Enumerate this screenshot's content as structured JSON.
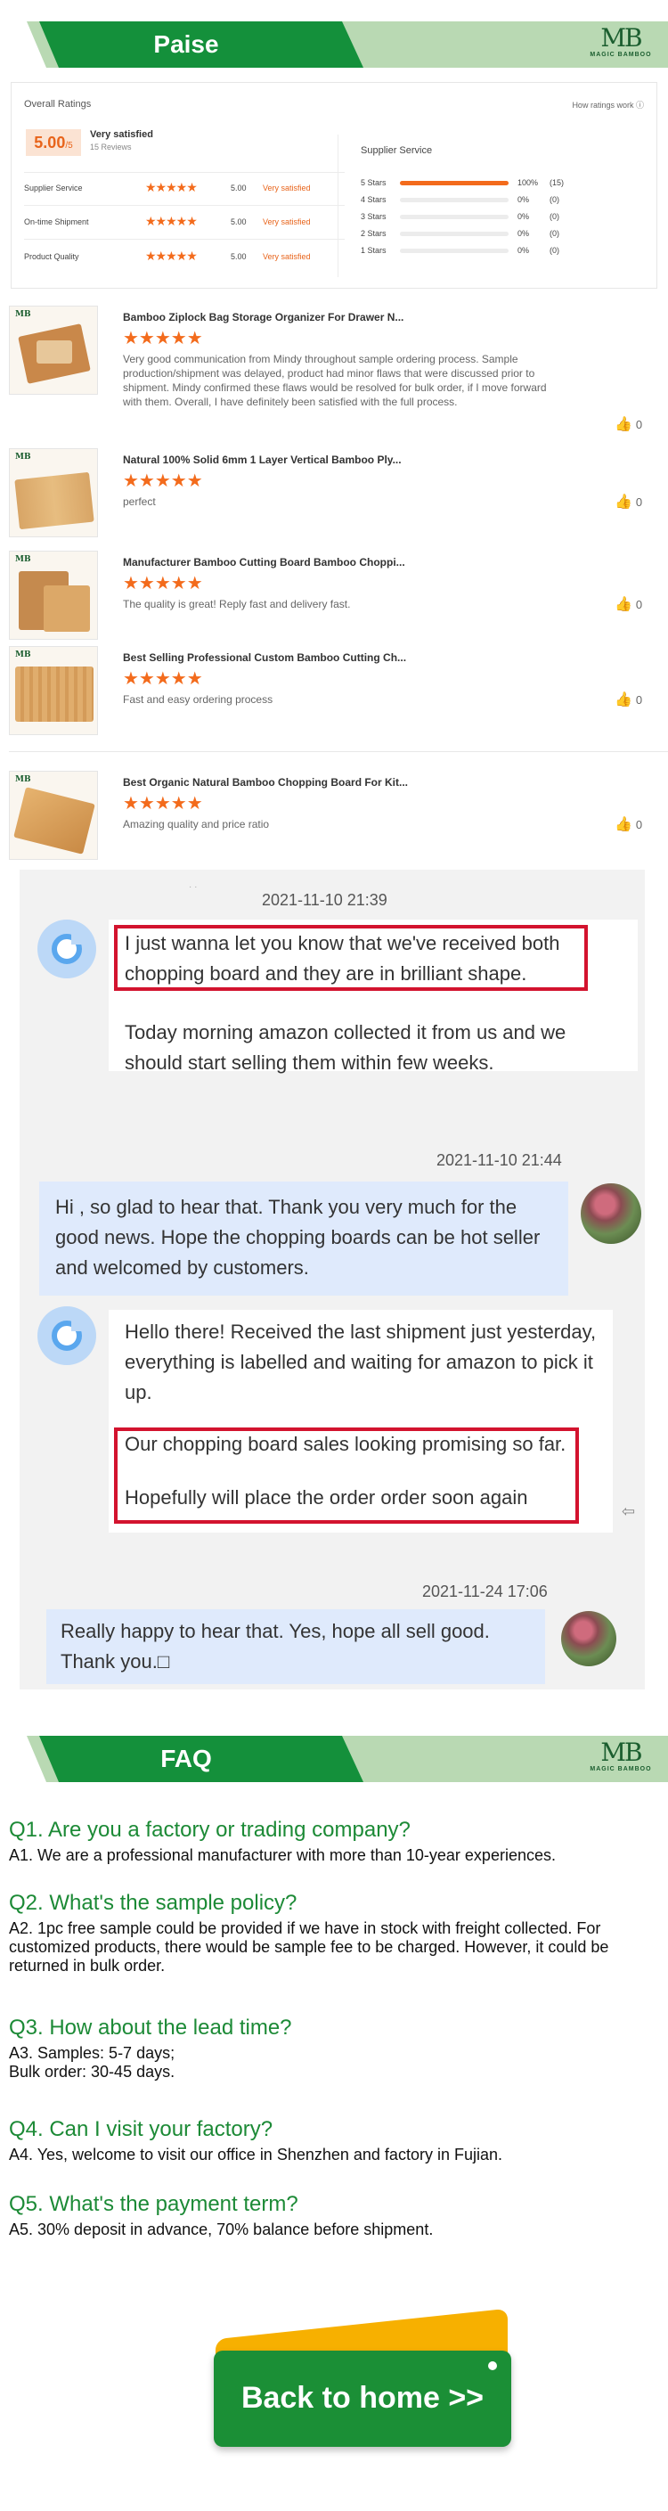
{
  "banner_paise": {
    "title": "Paise",
    "logo_mark": "MB",
    "logo_text": "MAGIC BAMBOO"
  },
  "ratings": {
    "title": "Overall Ratings",
    "how_link": "How ratings work",
    "score": "5.00",
    "score_suffix": "/5",
    "verdict": "Very satisfied",
    "reviews_count": "15 Reviews",
    "categories": [
      {
        "label": "Supplier Service",
        "stars": 5,
        "value": "5.00",
        "verdict": "Very satisfied"
      },
      {
        "label": "On-time Shipment",
        "stars": 5,
        "value": "5.00",
        "verdict": "Very satisfied"
      },
      {
        "label": "Product Quality",
        "stars": 5,
        "value": "5.00",
        "verdict": "Very satisfied"
      }
    ],
    "service_title": "Supplier Service",
    "distribution": [
      {
        "label": "5 Stars",
        "fraction": 1.0,
        "pct": "100%",
        "count": "(15)"
      },
      {
        "label": "4 Stars",
        "fraction": 0,
        "pct": "0%",
        "count": "(0)"
      },
      {
        "label": "3 Stars",
        "fraction": 0,
        "pct": "0%",
        "count": "(0)"
      },
      {
        "label": "2 Stars",
        "fraction": 0,
        "pct": "0%",
        "count": "(0)"
      },
      {
        "label": "1 Stars",
        "fraction": 0,
        "pct": "0%",
        "count": "(0)"
      }
    ]
  },
  "reviews": [
    {
      "product": "Bamboo Ziplock Bag Storage Organizer For Drawer N...",
      "stars": 5,
      "text": "Very good communication from Mindy throughout sample ordering process. Sample production/shipment was delayed, product had minor flaws that were discussed prior to shipment. Mindy confirmed these flaws would be resolved for bulk order, if I move forward with them. Overall, I have definitely been satisfied with the full process.",
      "likes": "0"
    },
    {
      "product": "Natural 100% Solid 6mm 1 Layer Vertical Bamboo Ply...",
      "stars": 5,
      "text": "perfect",
      "likes": "0"
    },
    {
      "product": "Manufacturer Bamboo Cutting Board Bamboo Choppi...",
      "stars": 5,
      "text": "The quality is great! Reply fast and delivery fast.",
      "likes": "0"
    },
    {
      "product": "Best Selling Professional Custom Bamboo Cutting Ch...",
      "stars": 5,
      "text": "Fast and easy ordering process",
      "likes": "0"
    },
    {
      "product": "Best Organic Natural Bamboo Chopping Board For Kit...",
      "stars": 5,
      "text": "Amazing quality and price ratio",
      "likes": "0"
    }
  ],
  "chat": {
    "dots": "·  ·",
    "ts1": "2021-11-10 21:39",
    "msg1a": "I just wanna let you know that we've received both chopping board and they are in brilliant shape.",
    "msg1b": "Today morning amazon collected it from us and we should start selling them within few weeks.",
    "ts2": "2021-11-10 21:44",
    "msg2": "Hi            , so glad to hear that. Thank you very much for the good news. Hope the chopping boards can be hot seller and welcomed by customers.",
    "msg3a": "Hello there! Received the last shipment just yesterday, everything is labelled and waiting for amazon to pick it up.",
    "msg3b": "Our chopping board sales looking promising so far.",
    "msg3c": "Hopefully will place the order order soon again",
    "ts3": "2021-11-24 17:06",
    "msg4": "Really happy to hear that. Yes, hope all sell good. Thank you.□"
  },
  "banner_faq": {
    "title": "FAQ",
    "logo_mark": "MB",
    "logo_text": "MAGIC BAMBOO"
  },
  "faq": [
    {
      "q": "Q1. Are you a factory or trading company?",
      "a": "A1. We are a professional manufacturer with more than 10-year experiences."
    },
    {
      "q": "Q2. What's the sample policy?",
      "a": "A2. 1pc free sample could be provided if we have in stock with freight collected. For customized products, there would be sample fee to be charged. However, it could be returned in bulk order."
    },
    {
      "q": "Q3. How about the lead time?",
      "a1": "A3. Samples: 5-7 days;",
      "a2": "Bulk order: 30-45 days."
    },
    {
      "q": "Q4. Can I visit your factory?",
      "a": "A4. Yes, welcome to visit our office in Shenzhen and factory in Fujian."
    },
    {
      "q": "Q5. What's the payment term?",
      "a": "A5. 30% deposit in advance, 70% balance before shipment."
    }
  ],
  "home_button": {
    "label": "Back to home  >>"
  },
  "colors": {
    "brand_green": "#14903b",
    "light_green": "#b9d9b3",
    "accent_orange": "#f36b1c",
    "highlight_red": "#d3132e"
  }
}
